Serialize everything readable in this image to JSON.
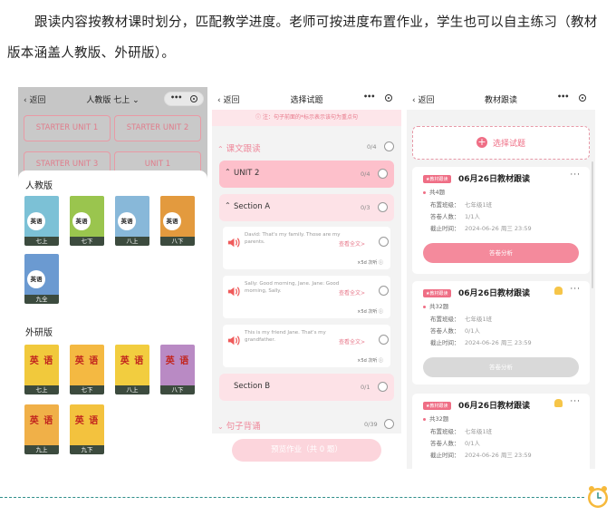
{
  "intro_text": "跟读内容按教材课时划分，匹配教学进度。老师可按进度布置作业，学生也可以自主练习（教材版本涵盖人教版、外研版）。",
  "screen1": {
    "back": "返回",
    "title": "人教版 七上",
    "title_chev": "⌄",
    "units": [
      "STARTER UNIT 1",
      "STARTER UNIT 2",
      "STARTER UNIT 3",
      "UNIT 1"
    ],
    "pub1": {
      "name": "人教版",
      "books": [
        {
          "label": "七上",
          "badge": "英语",
          "color": "#7cc1d6"
        },
        {
          "label": "七下",
          "badge": "英语",
          "color": "#9ac54e"
        },
        {
          "label": "八上",
          "badge": "英语",
          "color": "#88b8d9"
        },
        {
          "label": "八下",
          "badge": "英语",
          "color": "#e39a3e"
        },
        {
          "label": "九全",
          "badge": "英语",
          "color": "#6b9ad1"
        }
      ]
    },
    "pub2": {
      "name": "外研版",
      "books": [
        {
          "label": "七上",
          "title": "英 语",
          "color": "#f1c93c"
        },
        {
          "label": "七下",
          "title": "英 语",
          "color": "#f4b942"
        },
        {
          "label": "八上",
          "title": "英 语",
          "color": "#f2cd3f"
        },
        {
          "label": "八下",
          "title": "英 语",
          "color": "#b98ac4"
        },
        {
          "label": "九上",
          "title": "英 语",
          "color": "#f0b048"
        },
        {
          "label": "九下",
          "title": "英 语",
          "color": "#f3c23e"
        }
      ]
    }
  },
  "screen2": {
    "back": "返回",
    "title": "选择试题",
    "hint": "ⓘ 注：句子前面的*标示表示该句为重点句",
    "group1": {
      "name": "课文跟读",
      "count": "0/4"
    },
    "unit": {
      "name": "UNIT 2",
      "count": "0/4"
    },
    "sectionA": {
      "name": "Section A",
      "count": "0/3"
    },
    "sentences": [
      {
        "text": "David: That's my family. Those are my parents.",
        "view": "查看全文>",
        "meta": "×5d 次听 ⓘ"
      },
      {
        "text": "Sally: Good morning, Jane. Jane: Good morning, Sally.",
        "view": "查看全文>",
        "meta": "×5d 次听 ⓘ"
      },
      {
        "text": "This is my friend Jane. That's my grandfather.",
        "view": "查看全文>",
        "meta": "×5d 次听 ⓘ"
      }
    ],
    "sectionB": {
      "name": "Section B",
      "count": "0/1"
    },
    "group2": {
      "name": "句子背诵",
      "count": "0/39"
    },
    "assign_button": "预览作业（共 0 题）"
  },
  "screen3": {
    "back": "返回",
    "title": "教材跟读",
    "add_label": "选择试题",
    "cards": [
      {
        "tag": "教材跟读",
        "title": "06月26日教材跟读",
        "qcount": "共4题",
        "class": "七年级1班",
        "answered": "1/1人",
        "deadline": "2024-06-26 周三 23:59",
        "button": "答卷分析",
        "active": true,
        "bell": false
      },
      {
        "tag": "教材跟读",
        "title": "06月26日教材跟读",
        "qcount": "共32题",
        "class": "七年级1班",
        "answered": "0/1人",
        "deadline": "2024-06-26 周三 23:59",
        "button": "答卷分析",
        "active": false,
        "bell": true
      },
      {
        "tag": "教材跟读",
        "title": "06月26日教材跟读",
        "qcount": "共32题",
        "class": "七年级1班",
        "answered": "0/1人",
        "deadline": "2024-06-26 周三 23:59",
        "button": "答卷分析",
        "active": false,
        "bell": true
      }
    ],
    "labels": {
      "class": "布置班级：",
      "answered": "答卷人数：",
      "deadline": "截止时间："
    }
  },
  "colors": {
    "accent": "#ef6e85",
    "pink_light": "#fcd5dc",
    "disabled": "#d9d9d9",
    "divider": "#2f8f8a"
  }
}
